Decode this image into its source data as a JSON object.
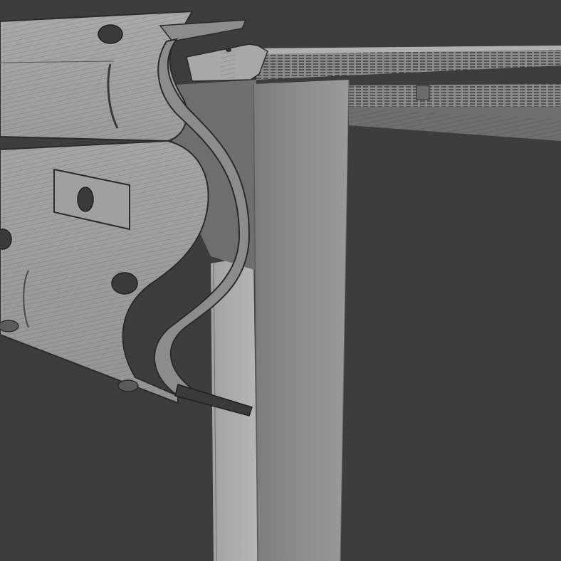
{
  "scene": {
    "subject": "guardrail-wireframe-render",
    "background_color": "#3d3d3d",
    "metal_color": "#9a9a9a",
    "wire_color": "#3a3a3a",
    "post_color": "#8f8f8f",
    "icons": [
      "bolt-hole-icon",
      "spacer-plate-icon"
    ]
  }
}
